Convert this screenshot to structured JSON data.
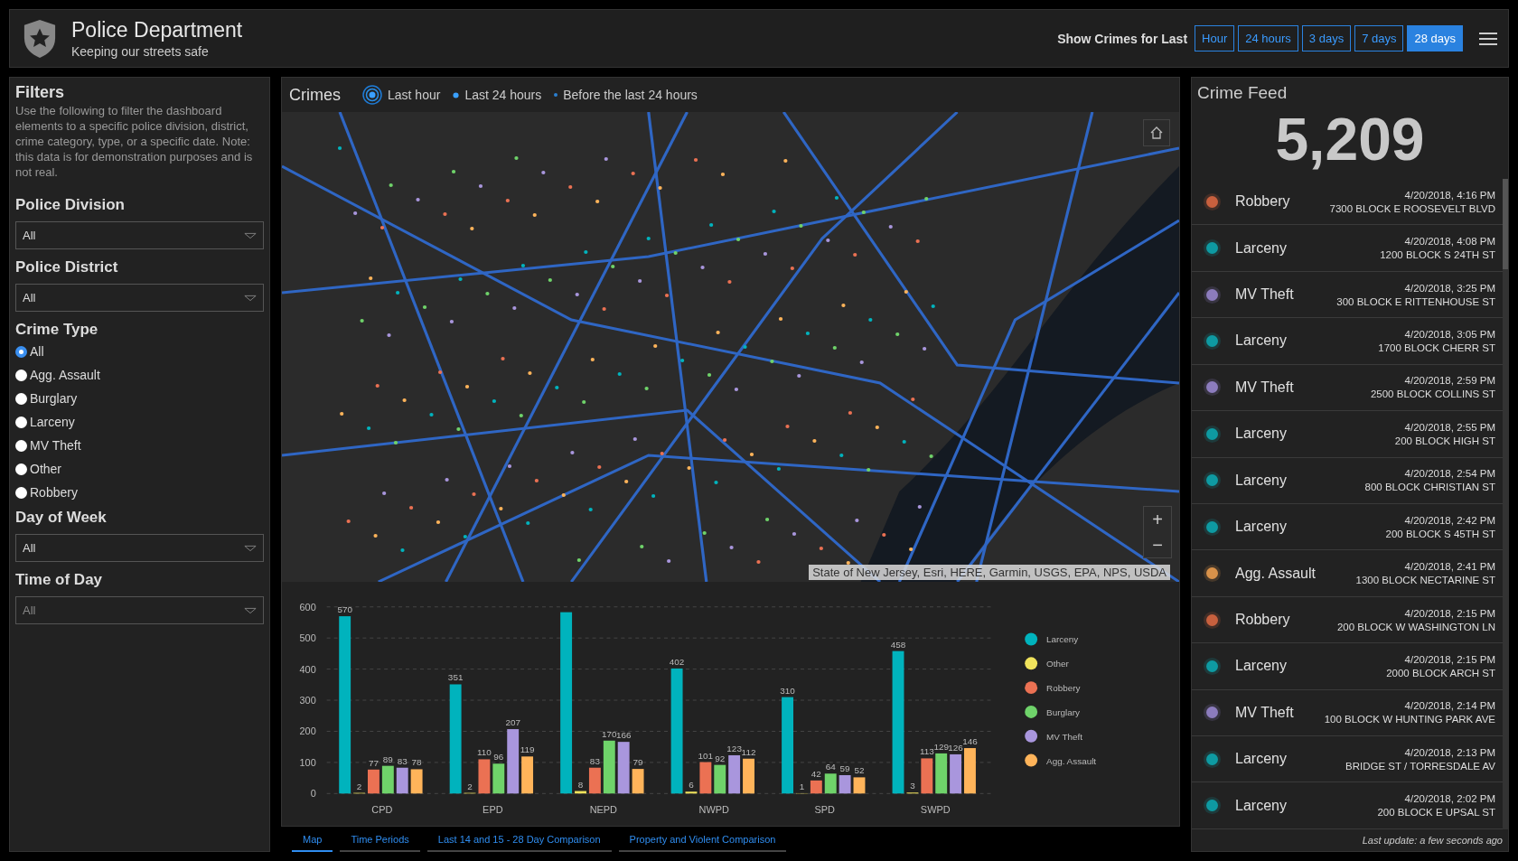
{
  "header": {
    "title": "Police Department",
    "subtitle": "Keeping our streets safe",
    "period_label": "Show Crimes for Last",
    "periods": [
      {
        "label": "Hour",
        "selected": false
      },
      {
        "label": "24 hours",
        "selected": false
      },
      {
        "label": "3 days",
        "selected": false
      },
      {
        "label": "7 days",
        "selected": false
      },
      {
        "label": "28 days",
        "selected": true
      }
    ]
  },
  "filters": {
    "title": "Filters",
    "description": "Use the following to filter the dashboard elements to a specific police division, district, crime category, type, or a specific date. Note: this data is for demonstration purposes and is not real.",
    "sections": [
      {
        "kind": "dropdown",
        "label": "Police Division",
        "value": "All",
        "disabled": false
      },
      {
        "kind": "dropdown",
        "label": "Police District",
        "value": "All",
        "disabled": false
      },
      {
        "kind": "radio",
        "label": "Crime Type",
        "options": [
          {
            "label": "All",
            "selected": true
          },
          {
            "label": "Agg. Assault",
            "selected": false
          },
          {
            "label": "Burglary",
            "selected": false
          },
          {
            "label": "Larceny",
            "selected": false
          },
          {
            "label": "MV Theft",
            "selected": false
          },
          {
            "label": "Other",
            "selected": false
          },
          {
            "label": "Robbery",
            "selected": false
          }
        ]
      },
      {
        "kind": "dropdown",
        "label": "Day of Week",
        "value": "All",
        "disabled": false
      },
      {
        "kind": "dropdown",
        "label": "Time of Day",
        "value": "All",
        "disabled": true
      }
    ]
  },
  "crimes": {
    "title": "Crimes",
    "legend": [
      {
        "kind": "pulse",
        "label": "Last hour"
      },
      {
        "kind": "dot",
        "label": "Last 24 hours"
      },
      {
        "kind": "small",
        "label": "Before the last 24 hours"
      }
    ],
    "map": {
      "attribution": "State of New Jersey, Esri, HERE, Garmin, USGS, EPA, NPS, USDA",
      "zoom_in": "+",
      "zoom_out": "−"
    },
    "chart_data": {
      "type": "bar",
      "grid": true,
      "legend": "right",
      "categories": [
        "CPD",
        "EPD",
        "NEPD",
        "NWPD",
        "SPD",
        "SWPD"
      ],
      "ylim": [
        0,
        600
      ],
      "yticks": [
        0,
        100,
        200,
        300,
        400,
        500,
        600
      ],
      "series": [
        {
          "name": "Larceny",
          "color": "#00b3bd",
          "values": [
            570,
            351,
            583,
            402,
            310,
            458
          ],
          "value_labels": [
            "570",
            "351",
            null,
            "402",
            "310",
            "458"
          ]
        },
        {
          "name": "Other",
          "color": "#f0e35c",
          "values": [
            2,
            2,
            8,
            6,
            1,
            3
          ],
          "value_labels": [
            "2",
            "2",
            "8",
            "6",
            "1",
            "3"
          ]
        },
        {
          "name": "Robbery",
          "color": "#eb7153",
          "values": [
            77,
            110,
            83,
            101,
            42,
            113
          ],
          "value_labels": [
            "77",
            "110",
            "83",
            "101",
            "42",
            "113"
          ]
        },
        {
          "name": "Burglary",
          "color": "#6fd36a",
          "values": [
            89,
            96,
            170,
            92,
            64,
            129
          ],
          "value_labels": [
            "89",
            "96",
            "170",
            "92",
            "64",
            "129"
          ]
        },
        {
          "name": "MV Theft",
          "color": "#a996dd",
          "values": [
            83,
            207,
            166,
            123,
            59,
            126
          ],
          "value_labels": [
            "83",
            "207",
            "166",
            "123",
            "59",
            "126"
          ]
        },
        {
          "name": "Agg. Assault",
          "color": "#ffb45a",
          "values": [
            78,
            119,
            79,
            112,
            52,
            146
          ],
          "value_labels": [
            "78",
            "119",
            "79",
            "112",
            "52",
            "146"
          ]
        }
      ]
    },
    "tabs": [
      {
        "label": "Map",
        "selected": true
      },
      {
        "label": "Time Periods",
        "selected": false
      },
      {
        "label": "Last 14 and 15 - 28 Day Comparison",
        "selected": false
      },
      {
        "label": "Property and Violent Comparison",
        "selected": false
      }
    ]
  },
  "feed": {
    "title": "Crime Feed",
    "total": "5,209",
    "footer": "Last update: a few seconds ago",
    "items": [
      {
        "type": "Robbery",
        "color": "#c8603e",
        "time": "4/20/2018, 4:16 PM",
        "address": "7300 BLOCK E ROOSEVELT BLVD"
      },
      {
        "type": "Larceny",
        "color": "#0e9aa2",
        "time": "4/20/2018, 4:08 PM",
        "address": "1200 BLOCK S 24TH ST"
      },
      {
        "type": "MV Theft",
        "color": "#8c7cbd",
        "time": "4/20/2018, 3:25 PM",
        "address": "300 BLOCK E RITTENHOUSE ST"
      },
      {
        "type": "Larceny",
        "color": "#0e9aa2",
        "time": "4/20/2018, 3:05 PM",
        "address": "1700 BLOCK CHERR ST"
      },
      {
        "type": "MV Theft",
        "color": "#8c7cbd",
        "time": "4/20/2018, 2:59 PM",
        "address": "2500 BLOCK COLLINS ST"
      },
      {
        "type": "Larceny",
        "color": "#0e9aa2",
        "time": "4/20/2018, 2:55 PM",
        "address": "200 BLOCK HIGH ST"
      },
      {
        "type": "Larceny",
        "color": "#0e9aa2",
        "time": "4/20/2018, 2:54 PM",
        "address": "800 BLOCK CHRISTIAN ST"
      },
      {
        "type": "Larceny",
        "color": "#0e9aa2",
        "time": "4/20/2018, 2:42 PM",
        "address": "200 BLOCK S 45TH ST"
      },
      {
        "type": "Agg. Assault",
        "color": "#d9924a",
        "time": "4/20/2018, 2:41 PM",
        "address": "1300 BLOCK NECTARINE ST"
      },
      {
        "type": "Robbery",
        "color": "#c8603e",
        "time": "4/20/2018, 2:15 PM",
        "address": "200 BLOCK W WASHINGTON LN"
      },
      {
        "type": "Larceny",
        "color": "#0e9aa2",
        "time": "4/20/2018, 2:15 PM",
        "address": "2000 BLOCK ARCH ST"
      },
      {
        "type": "MV Theft",
        "color": "#8c7cbd",
        "time": "4/20/2018, 2:14 PM",
        "address": "100 BLOCK W HUNTING PARK AVE"
      },
      {
        "type": "Larceny",
        "color": "#0e9aa2",
        "time": "4/20/2018, 2:13 PM",
        "address": "BRIDGE ST / TORRESDALE AV"
      },
      {
        "type": "Larceny",
        "color": "#0e9aa2",
        "time": "4/20/2018, 2:02 PM",
        "address": "200 BLOCK E UPSAL ST"
      }
    ]
  }
}
